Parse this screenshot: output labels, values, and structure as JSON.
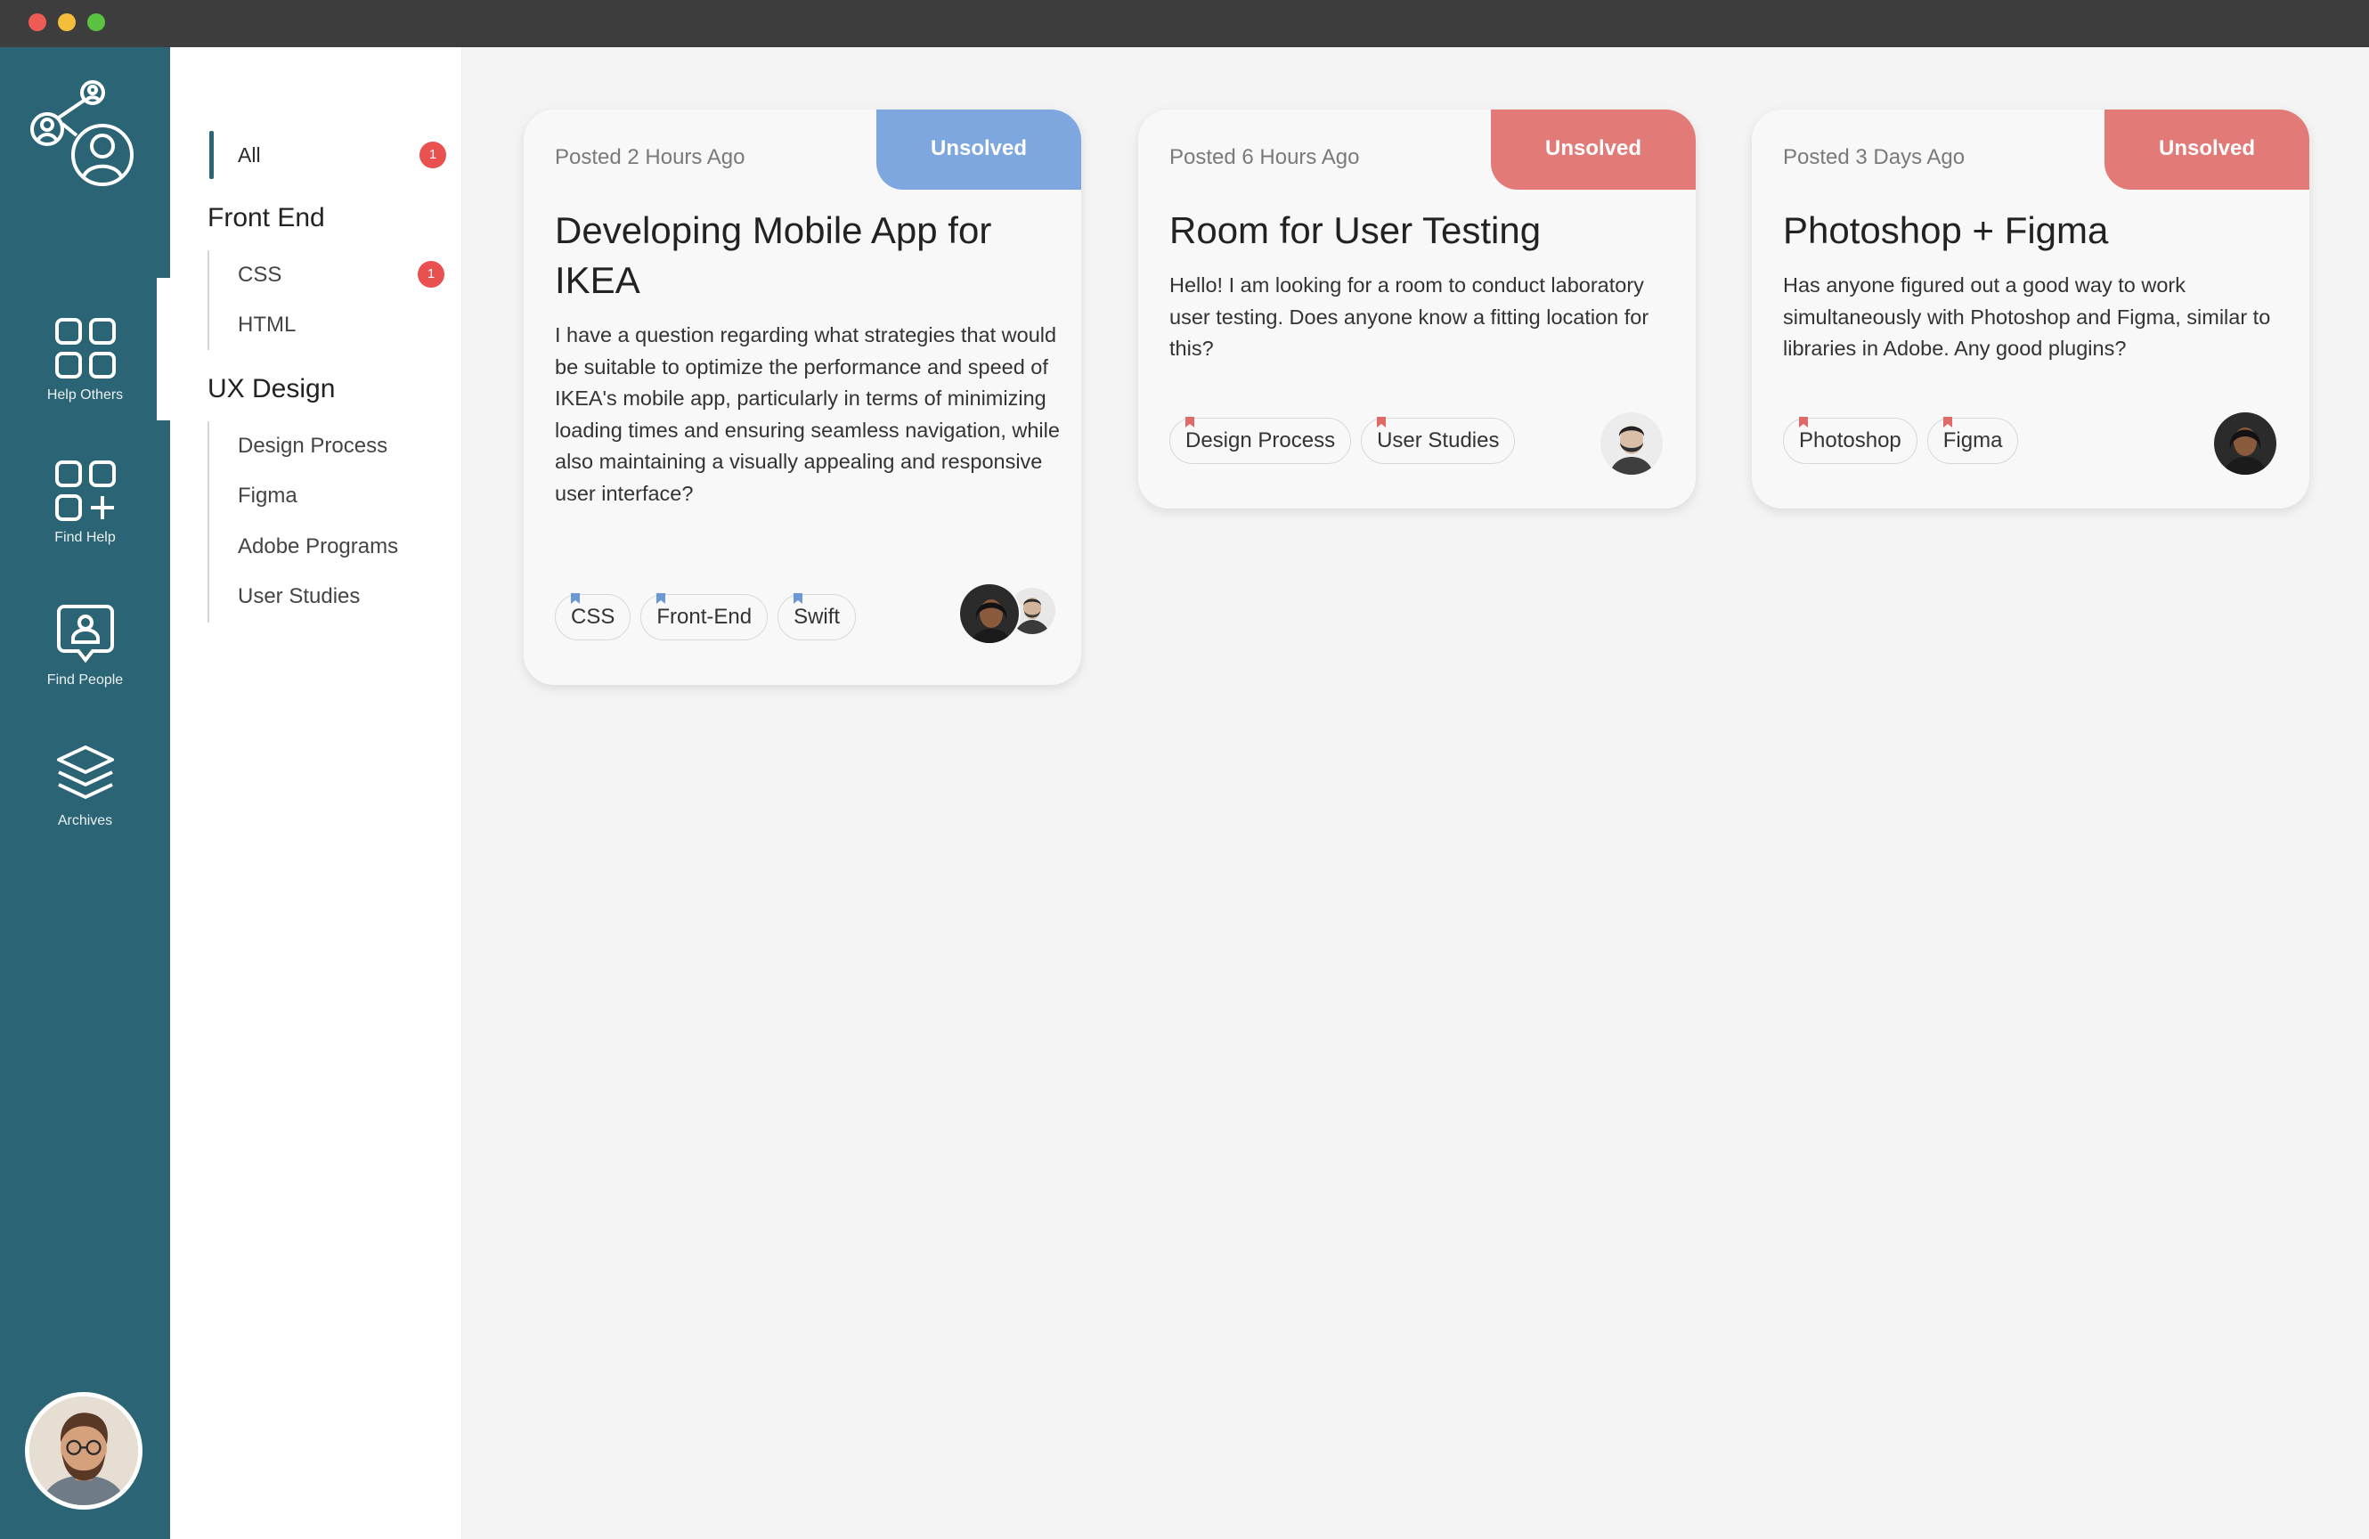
{
  "window": {
    "controls": [
      "close",
      "minimize",
      "maximize"
    ]
  },
  "colors": {
    "rail": "#2b6474",
    "status_blue": "#7fa7df",
    "status_red": "#e27a78",
    "badge": "#e8514f",
    "flag_blue": "#6c98d8",
    "flag_red": "#e06a68"
  },
  "rail": {
    "logo_icon": "people-network-logo",
    "items": [
      {
        "label": "Help Others",
        "icon": "grid-icon"
      },
      {
        "label": "Find Help",
        "icon": "grid-plus-icon"
      },
      {
        "label": "Find People",
        "icon": "person-badge-icon"
      },
      {
        "label": "Archives",
        "icon": "layers-icon"
      }
    ],
    "active_index": 0,
    "avatar": "user-avatar"
  },
  "categories": {
    "all": {
      "label": "All",
      "badge": "1"
    },
    "groups": [
      {
        "heading": "Front End",
        "items": [
          {
            "label": "CSS",
            "badge": "1"
          },
          {
            "label": "HTML"
          }
        ]
      },
      {
        "heading": "UX Design",
        "items": [
          {
            "label": "Design Process"
          },
          {
            "label": "Figma"
          },
          {
            "label": "Adobe Programs"
          },
          {
            "label": "User Studies"
          }
        ]
      }
    ]
  },
  "cards": [
    {
      "posted": "Posted 2 Hours Ago",
      "status": "Unsolved",
      "status_color": "#7fa7df",
      "title": "Developing Mobile App for IKEA",
      "body": "I have a question regarding what strategies that would be suitable to optimize the performance and speed of IKEA's mobile app, particularly in terms of minimizing loading times and ensuring seamless navigation, while also maintaining a visually appealing and responsive user interface?",
      "tags": [
        "CSS",
        "Front-End",
        "Swift"
      ],
      "tag_flag_color": "#6c98d8"
    },
    {
      "posted": "Posted 6 Hours Ago",
      "status": "Unsolved",
      "status_color": "#e27a78",
      "title": "Room for User Testing",
      "body": "Hello! I am looking for a room to conduct laboratory user testing. Does anyone know a fitting location for this?",
      "tags": [
        "Design Process",
        "User Studies"
      ],
      "tag_flag_color": "#e06a68"
    },
    {
      "posted": "Posted 3 Days Ago",
      "status": "Unsolved",
      "status_color": "#e27a78",
      "title": "Photoshop + Figma",
      "body": "Has anyone figured out a good way to work simultaneously with Photoshop and Figma, similar to libraries in Adobe. Any good plugins?",
      "tags": [
        "Photoshop",
        "Figma"
      ],
      "tag_flag_color": "#e06a68"
    }
  ]
}
